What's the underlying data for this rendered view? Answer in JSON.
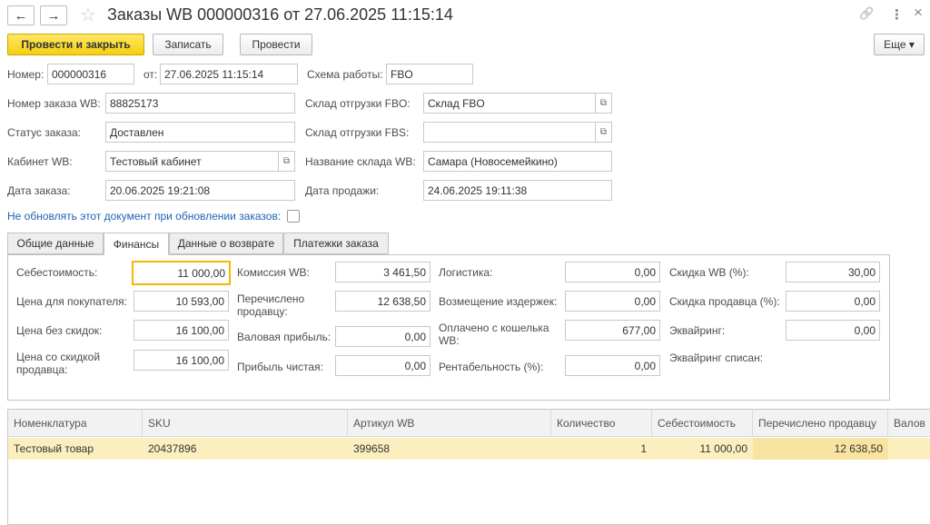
{
  "header": {
    "title": "Заказы WB 000000316 от 27.06.2025 11:15:14",
    "back_icon": "←",
    "forward_icon": "→",
    "star_icon": "☆",
    "link_icon": "🔗",
    "more_icon": "⋮",
    "close_icon": "×"
  },
  "toolbar": {
    "post_close": "Провести и закрыть",
    "save": "Записать",
    "post": "Провести",
    "more": "Еще ▾"
  },
  "form": {
    "number_label": "Номер:",
    "number": "000000316",
    "from_label": "от:",
    "date": "27.06.2025 11:15:14",
    "scheme_label": "Схема работы:",
    "scheme": "FBO",
    "order_wb_label": "Номер заказа WB:",
    "order_wb": "88825173",
    "fbo_label": "Склад отгрузки FBO:",
    "fbo": "Склад FBO",
    "status_label": "Статус заказа:",
    "status": "Доставлен",
    "fbs_label": "Склад отгрузки FBS:",
    "fbs": "",
    "cabinet_label": "Кабинет WB:",
    "cabinet": "Тестовый кабинет",
    "wh_name_label": "Название склада WB:",
    "wh_name": "Самара (Новосемейкино)",
    "order_date_label": "Дата заказа:",
    "order_date": "20.06.2025 19:21:08",
    "sale_date_label": "Дата продажи:",
    "sale_date": "24.06.2025 19:11:38",
    "no_update_label": "Не обновлять этот документ при обновлении заказов:",
    "select_icon": "⧉"
  },
  "tabs": [
    "Общие данные",
    "Финансы",
    "Данные о возврате",
    "Платежки заказа"
  ],
  "finance": {
    "cost_label": "Себестоимость:",
    "cost": "11 000,00",
    "buyer_price_label": "Цена для покупателя:",
    "buyer_price": "10 593,00",
    "no_discount_label": "Цена без скидок:",
    "no_discount": "16 100,00",
    "seller_discount_price_label": "Цена со скидкой продавца:",
    "seller_discount_price": "16 100,00",
    "commission_label": "Комиссия WB:",
    "commission": "3 461,50",
    "transferred_label": "Перечислено продавцу:",
    "transferred": "12 638,50",
    "gross_label": "Валовая прибыль:",
    "gross": "0,00",
    "net_label": "Прибыль чистая:",
    "net": "0,00",
    "logistics_label": "Логистика:",
    "logistics": "0,00",
    "reimb_label": "Возмещение издержек:",
    "reimb": "0,00",
    "wallet_label": "Оплачено с кошелька WB:",
    "wallet": "677,00",
    "profitability_label": "Рентабельность (%):",
    "profitability": "0,00",
    "wb_discount_label": "Скидка WB (%):",
    "wb_discount": "30,00",
    "seller_discount_label": "Скидка продавца (%):",
    "seller_discount": "0,00",
    "acquiring_label": "Эквайринг:",
    "acquiring": "0,00",
    "acquiring_written_label": "Эквайринг списан:"
  },
  "table": {
    "columns": [
      "Номенклатура",
      "SKU",
      "Артикул WB",
      "Количество",
      "Себестоимость",
      "Перечислено продавцу",
      "Валов"
    ],
    "rows": [
      [
        "Тестовый товар",
        "20437896",
        "399658",
        "1",
        "11 000,00",
        "12 638,50",
        ""
      ]
    ]
  }
}
